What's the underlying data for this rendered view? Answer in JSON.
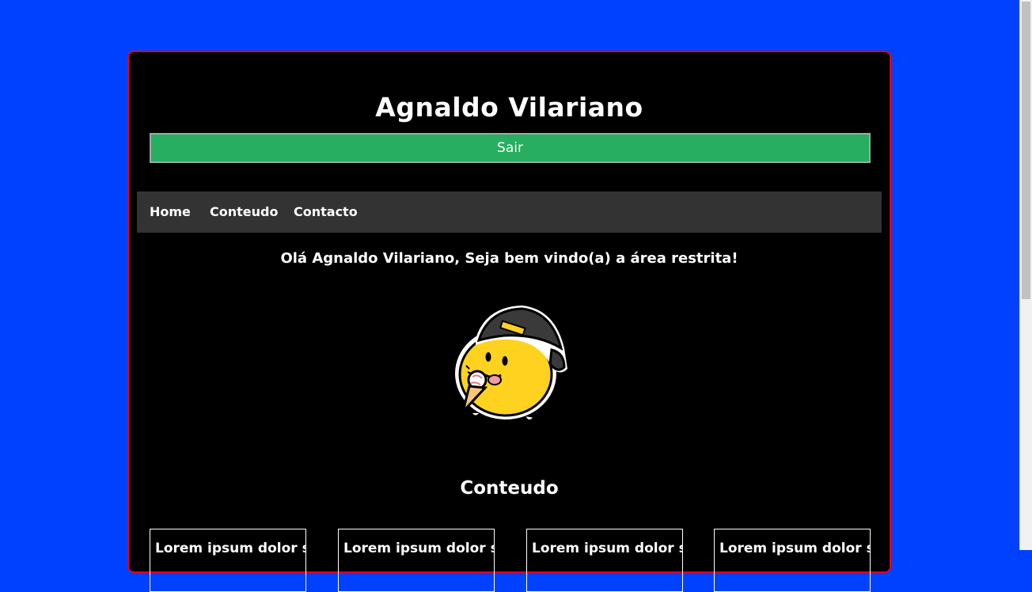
{
  "header": {
    "title": "Agnaldo Vilariano",
    "logout_label": "Sair"
  },
  "nav": {
    "items": [
      {
        "label": "Home"
      },
      {
        "label": "Conteudo"
      },
      {
        "label": "Contacto"
      }
    ]
  },
  "main": {
    "welcome": "Olá Agnaldo Vilariano, Seja bem vindo(a) a área restrita!",
    "section_title": "Conteudo",
    "cards": [
      {
        "text": "Lorem ipsum dolor sit"
      },
      {
        "text": "Lorem ipsum dolor sit"
      },
      {
        "text": "Lorem ipsum dolor sit"
      },
      {
        "text": "Lorem ipsum dolor sit"
      }
    ]
  },
  "colors": {
    "page_background": "#0041ff",
    "panel_background": "#000000",
    "panel_border": "#e00020",
    "logout_button": "#27ae60",
    "nav_background": "#333333"
  }
}
